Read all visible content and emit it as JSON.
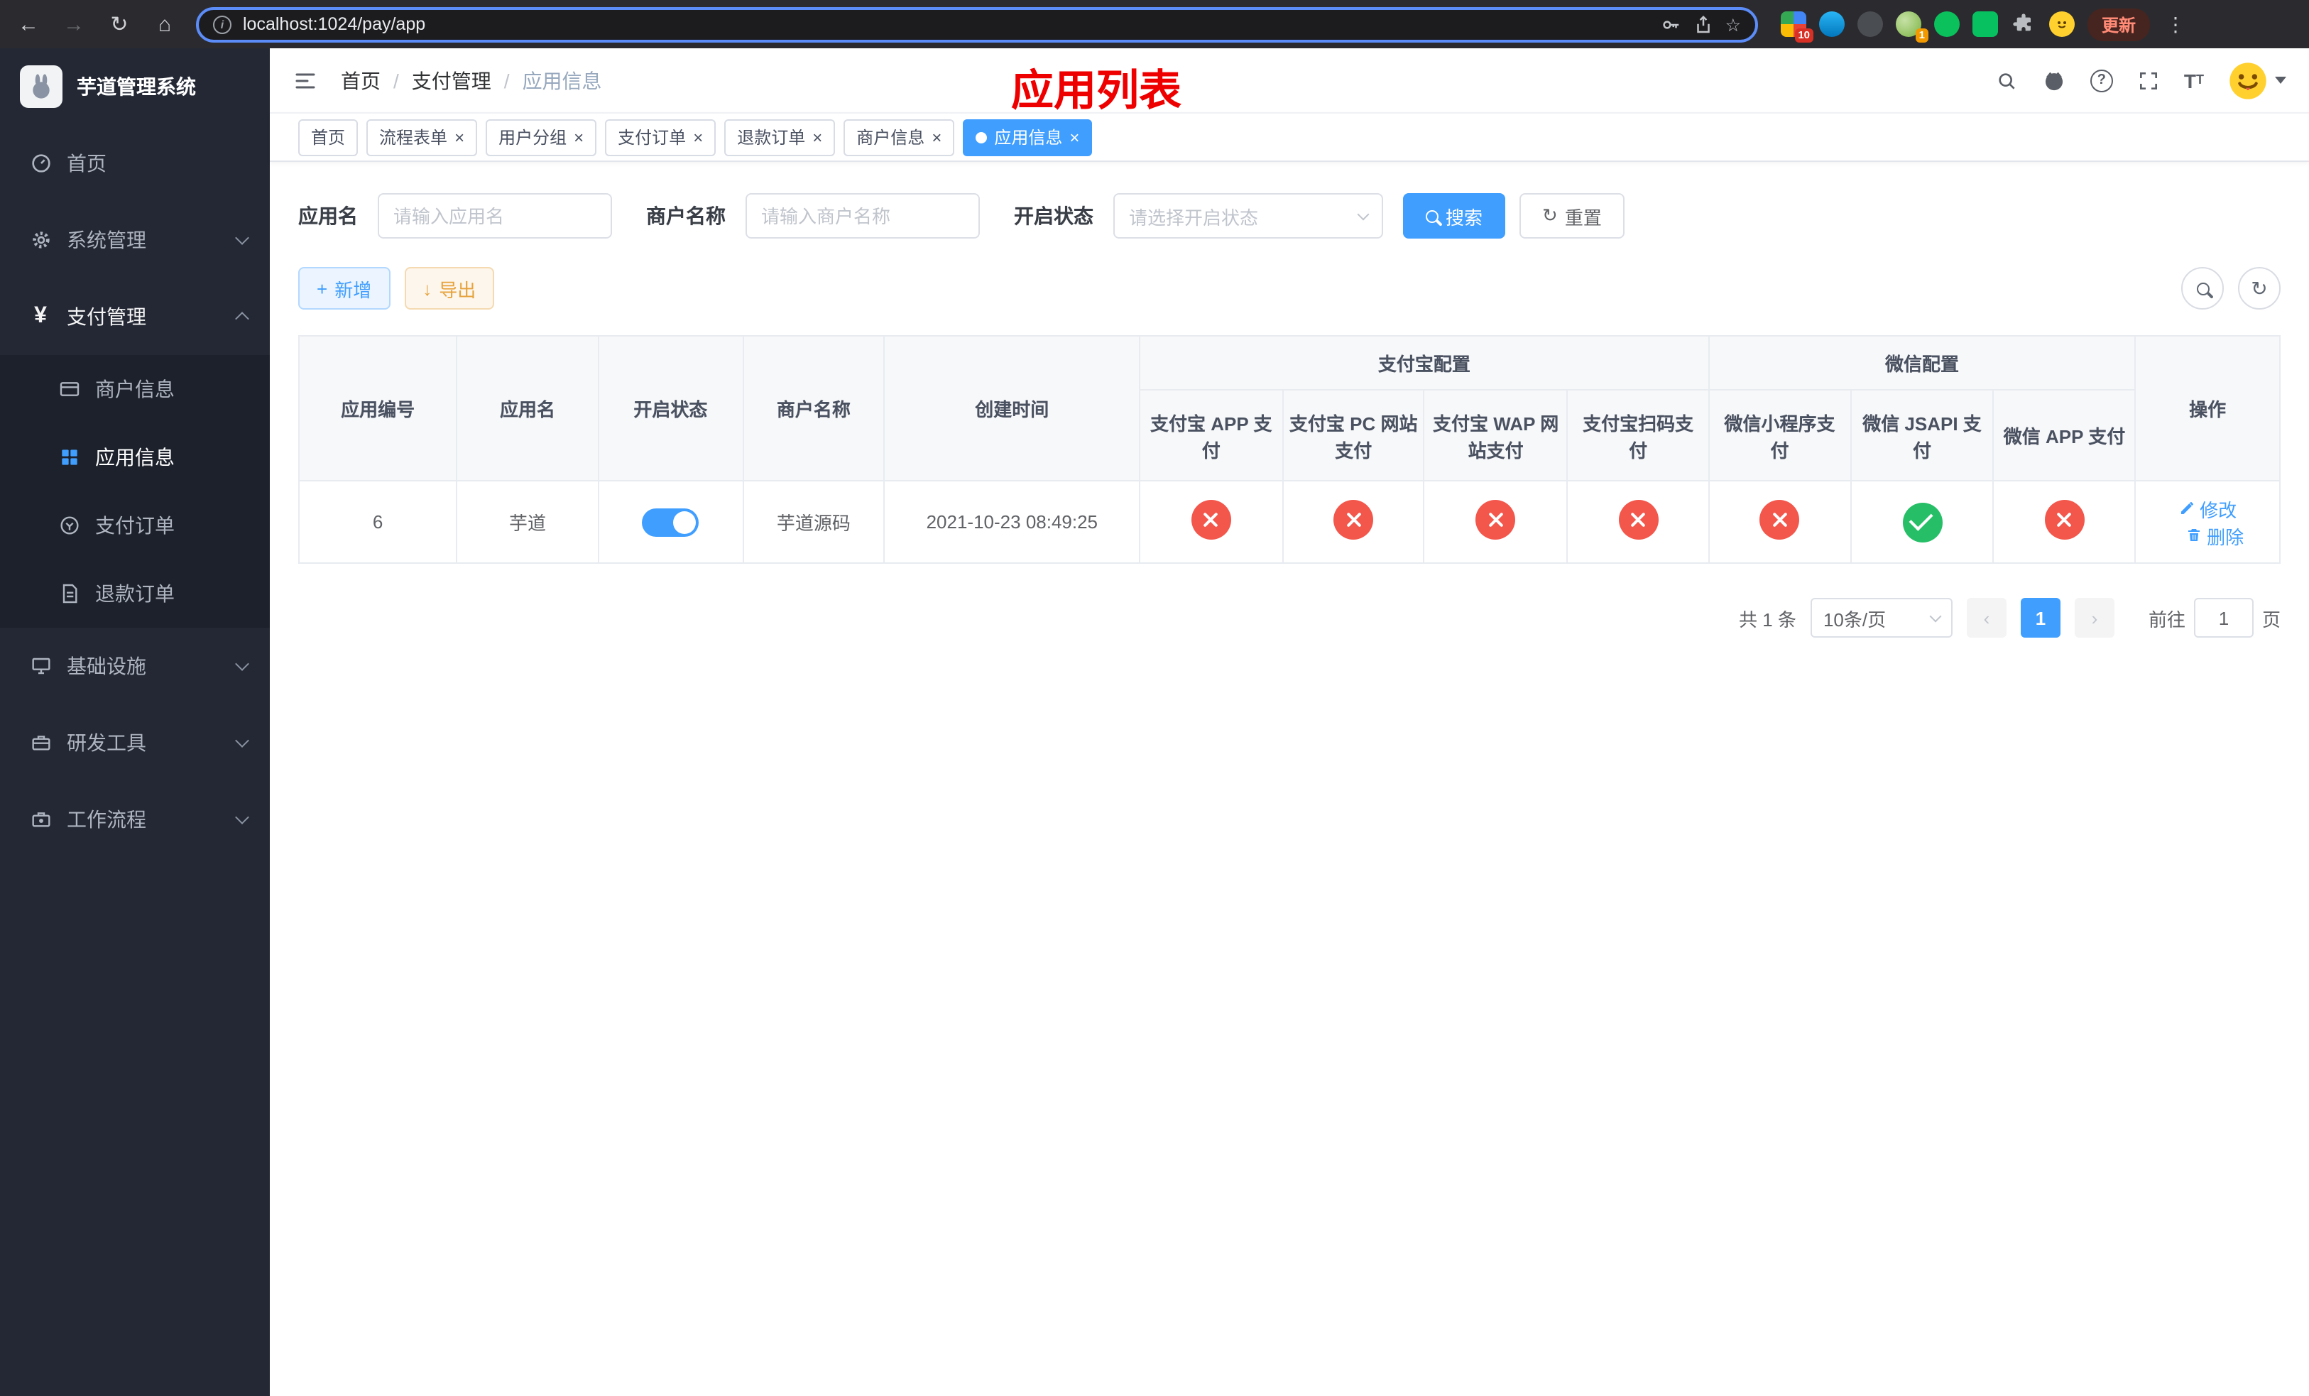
{
  "chrome": {
    "url": "localhost:1024/pay/app",
    "update_label": "更新",
    "badge_apps": "10",
    "badge_avatar": "1"
  },
  "sidebar": {
    "app_title": "芋道管理系统",
    "menu": [
      {
        "label": "首页"
      },
      {
        "label": "系统管理"
      },
      {
        "label": "支付管理"
      }
    ],
    "submenu": [
      {
        "label": "商户信息"
      },
      {
        "label": "应用信息"
      },
      {
        "label": "支付订单"
      },
      {
        "label": "退款订单"
      }
    ],
    "menu_bottom": [
      {
        "label": "基础设施"
      },
      {
        "label": "研发工具"
      },
      {
        "label": "工作流程"
      }
    ]
  },
  "header": {
    "breadcrumb": [
      "首页",
      "支付管理",
      "应用信息"
    ],
    "overlay_title": "应用列表"
  },
  "tabs": [
    {
      "label": "首页"
    },
    {
      "label": "流程表单"
    },
    {
      "label": "用户分组"
    },
    {
      "label": "支付订单"
    },
    {
      "label": "退款订单"
    },
    {
      "label": "商户信息"
    },
    {
      "label": "应用信息"
    }
  ],
  "filters": {
    "app_name_label": "应用名",
    "app_name_placeholder": "请输入应用名",
    "merchant_label": "商户名称",
    "merchant_placeholder": "请输入商户名称",
    "status_label": "开启状态",
    "status_placeholder": "请选择开启状态",
    "search_button": "搜索",
    "reset_button": "重置"
  },
  "toolbar": {
    "add_button": "新增",
    "export_button": "导出"
  },
  "table": {
    "group_headers": {
      "alipay": "支付宝配置",
      "wechat": "微信配置"
    },
    "columns": [
      "应用编号",
      "应用名",
      "开启状态",
      "商户名称",
      "创建时间",
      "支付宝 APP 支付",
      "支付宝 PC 网站支付",
      "支付宝 WAP 网站支付",
      "支付宝扫码支付",
      "微信小程序支付",
      "微信 JSAPI 支付",
      "微信 APP 支付",
      "操作"
    ],
    "row": {
      "id": "6",
      "name": "芋道",
      "enabled": true,
      "merchant": "芋道源码",
      "created_at": "2021-10-23 08:49:25",
      "alipay_app": "disabled",
      "alipay_pc": "disabled",
      "alipay_wap": "disabled",
      "alipay_qr": "disabled",
      "wechat_mini": "disabled",
      "wechat_jsapi": "enabled",
      "wechat_app": "disabled",
      "edit_label": "修改",
      "delete_label": "删除"
    }
  },
  "pagination": {
    "total": "共 1 条",
    "page_size": "10条/页",
    "current_page": "1",
    "goto_prefix": "前往",
    "goto_value": "1",
    "goto_suffix": "页"
  },
  "colors": {
    "primary": "#409eff",
    "danger_circle": "#f3564b",
    "success_circle": "#26bf67",
    "annotation_red": "#ee0000"
  }
}
